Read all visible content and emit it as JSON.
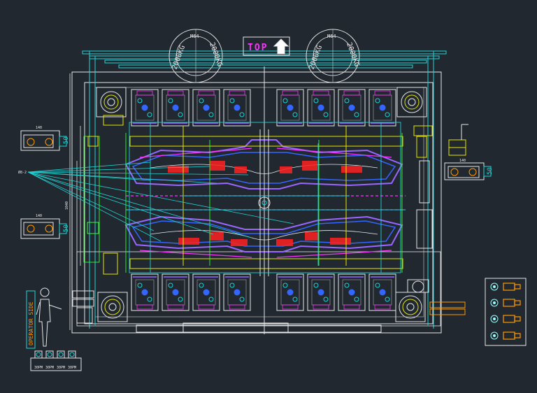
{
  "drawing": {
    "background": "#212830",
    "top_label": "TOP",
    "eyebolt_top_text": "M64",
    "eyebolt_ring_text": "2000KG",
    "operator_side_label": "OPERATOR SIDE",
    "water_port_labels": [
      "30PM",
      "30PM",
      "30PM",
      "30PM"
    ],
    "callout_label": "Ø8-2",
    "left_dim_text": "1040",
    "detail_dim_50": "50",
    "detail_dim_140": "140"
  },
  "colors": {
    "white": "#e8e8e8",
    "cyan": "#22d3d3",
    "yellow": "#e6e600",
    "magenta": "#ff33ff",
    "red": "#ff2020",
    "green": "#33ff33",
    "blue": "#3366ff",
    "orange": "#ff9900",
    "purple": "#9966ff",
    "gray": "#8a8a8a",
    "lightcyan": "#99ffff"
  }
}
